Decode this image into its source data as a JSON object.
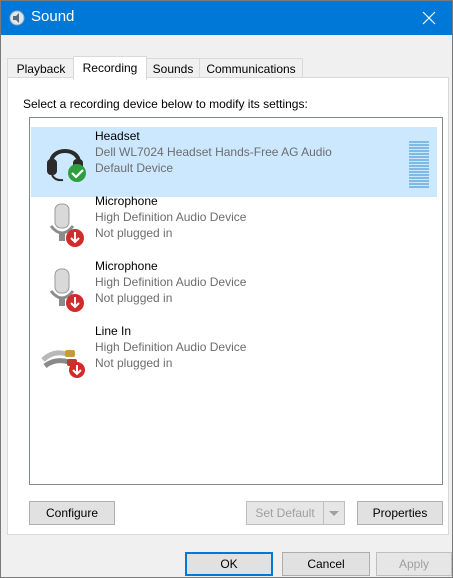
{
  "window": {
    "title": "Sound"
  },
  "tabs": [
    {
      "label": "Playback"
    },
    {
      "label": "Recording"
    },
    {
      "label": "Sounds"
    },
    {
      "label": "Communications"
    }
  ],
  "active_tab": "Recording",
  "instruction": "Select a recording device below to modify its settings:",
  "devices": [
    {
      "name": "Headset",
      "description": "Dell WL7024 Headset Hands-Free AG Audio",
      "status": "Default Device",
      "icon": "headset-icon",
      "badge": "green-check-icon",
      "selected": true
    },
    {
      "name": "Microphone",
      "description": "High Definition Audio Device",
      "status": "Not plugged in",
      "icon": "microphone-icon",
      "badge": "red-down-arrow-icon",
      "selected": false
    },
    {
      "name": "Microphone",
      "description": "High Definition Audio Device",
      "status": "Not plugged in",
      "icon": "microphone-icon",
      "badge": "red-down-arrow-icon",
      "selected": false
    },
    {
      "name": "Line In",
      "description": "High Definition Audio Device",
      "status": "Not plugged in",
      "icon": "line-in-cable-icon",
      "badge": "red-down-arrow-icon",
      "selected": false
    }
  ],
  "buttons": {
    "configure": "Configure",
    "set_default": "Set Default",
    "properties": "Properties",
    "ok": "OK",
    "cancel": "Cancel",
    "apply": "Apply"
  },
  "colors": {
    "titlebar": "#0078d7",
    "selection": "#cce8ff",
    "level_meter": "#7fbae4"
  }
}
